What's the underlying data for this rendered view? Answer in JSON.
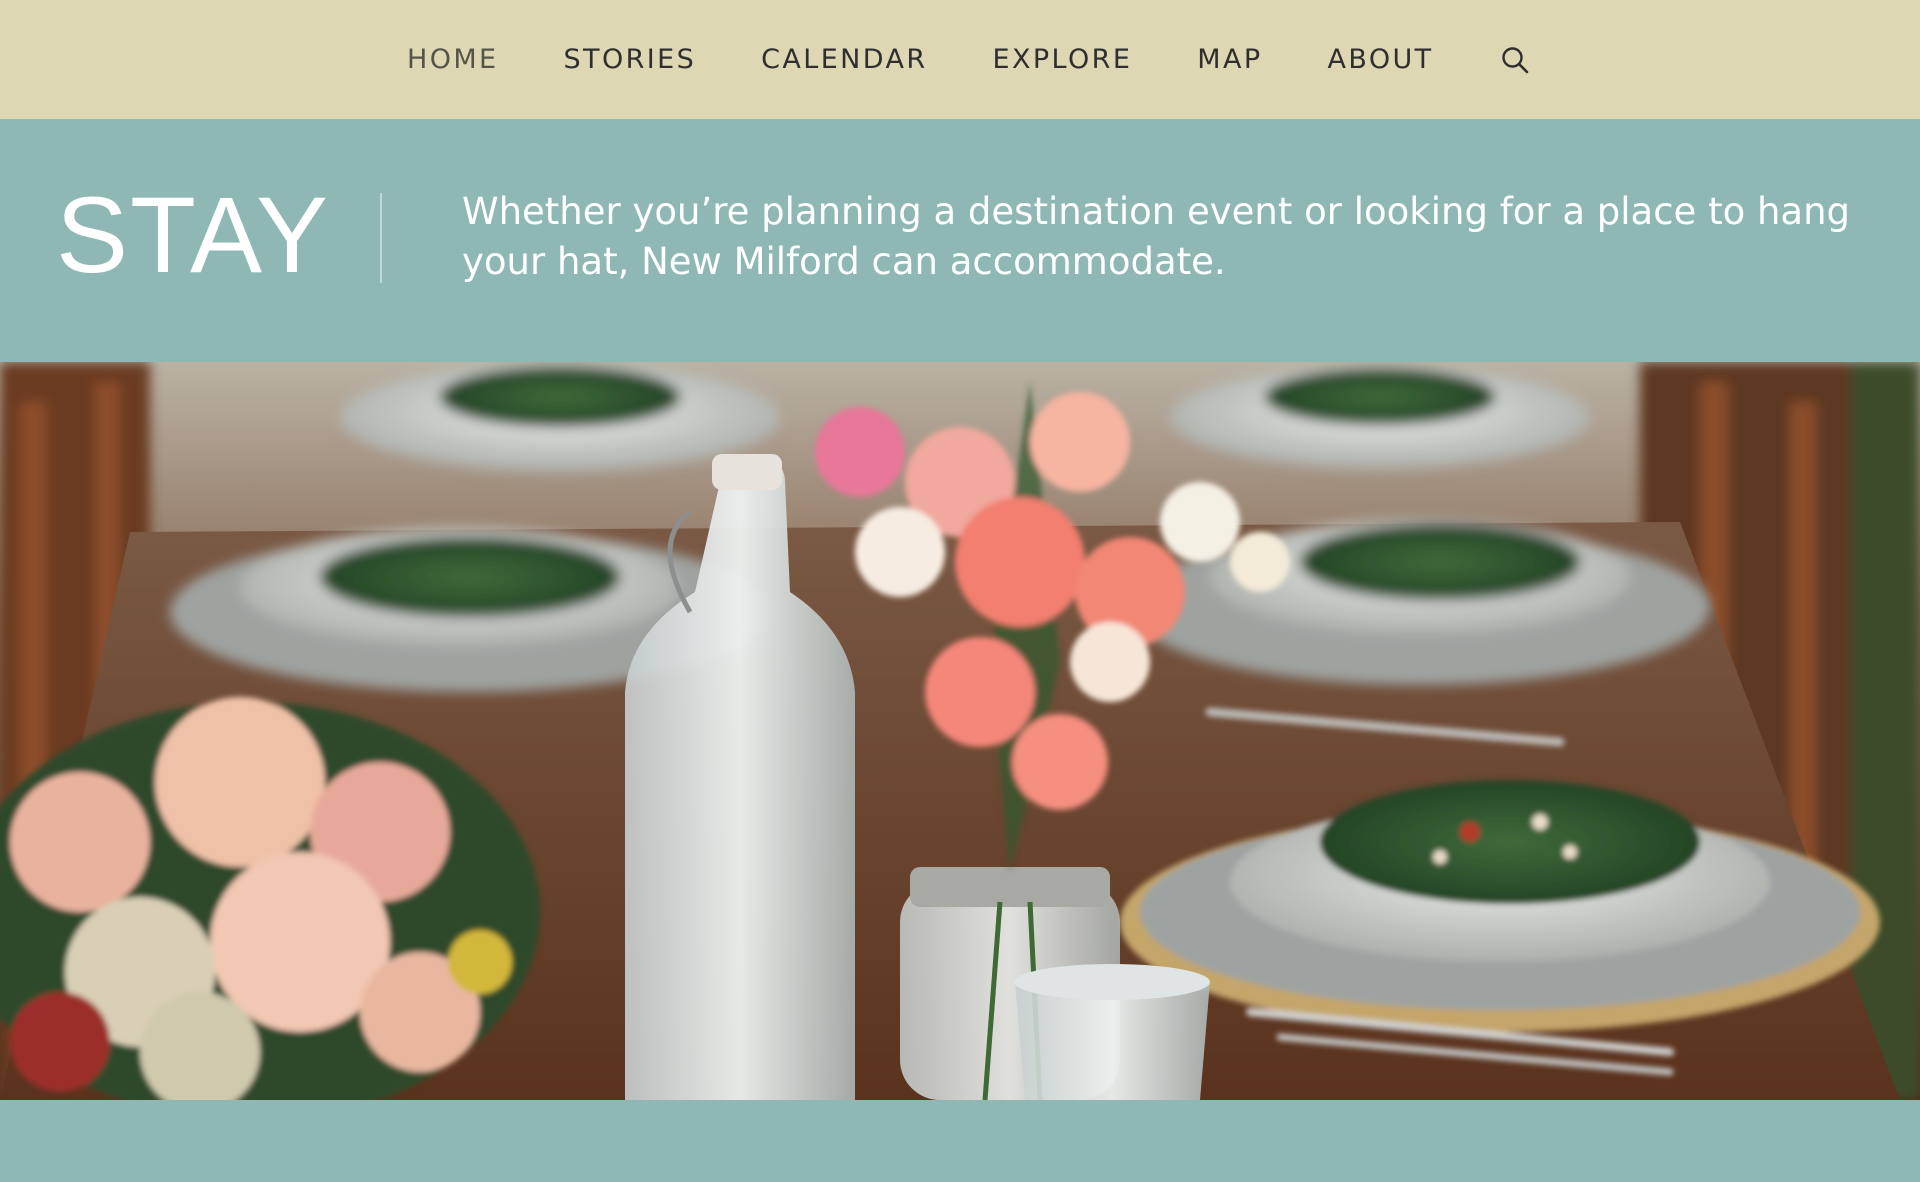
{
  "nav": {
    "items": [
      {
        "label": "HOME",
        "active": true
      },
      {
        "label": "STORIES",
        "active": false
      },
      {
        "label": "CALENDAR",
        "active": false
      },
      {
        "label": "EXPLORE",
        "active": false
      },
      {
        "label": "MAP",
        "active": false
      },
      {
        "label": "ABOUT",
        "active": false
      }
    ],
    "search_icon": "search-icon"
  },
  "hero": {
    "title": "STAY",
    "tagline": "Whether you’re planning a destination event or looking for a place to hang your hat, New Milford can accommodate."
  },
  "colors": {
    "nav_bg": "#ddd7b3",
    "band_bg": "#8fb8b4",
    "text_light": "#ffffff",
    "nav_text": "#2f2f2f"
  }
}
